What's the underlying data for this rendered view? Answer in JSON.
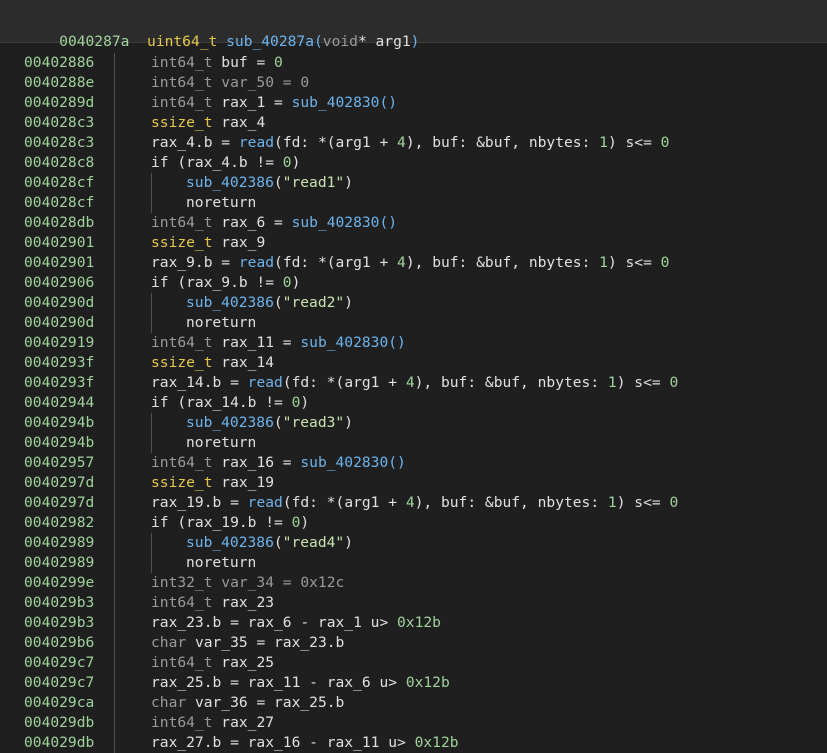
{
  "header": {
    "address": "0040287a",
    "return_type": "uint64_t",
    "function_name": "sub_40287a",
    "open_paren": "(",
    "param_type": "void",
    "param_rest": "* arg1",
    "close_paren": ")"
  },
  "lines": [
    {
      "addr": "00402886",
      "indent": 1,
      "tokens": [
        [
          "int64_t ",
          "dim"
        ],
        [
          "buf",
          ""
        ],
        [
          " = ",
          ""
        ],
        [
          "0",
          "num"
        ]
      ]
    },
    {
      "addr": "0040288e",
      "indent": 1,
      "tokens": [
        [
          "int64_t var_50 = 0",
          "dim"
        ]
      ]
    },
    {
      "addr": "0040289d",
      "indent": 1,
      "tokens": [
        [
          "int64_t ",
          "dim"
        ],
        [
          "rax_1",
          ""
        ],
        [
          " = ",
          ""
        ],
        [
          "sub_402830",
          "func"
        ],
        [
          "()",
          "func"
        ]
      ]
    },
    {
      "addr": "004028c3",
      "indent": 1,
      "tokens": [
        [
          "ssize_t ",
          "type"
        ],
        [
          "rax_4",
          ""
        ]
      ]
    },
    {
      "addr": "004028c3",
      "indent": 1,
      "tokens": [
        [
          "rax_4.b = ",
          ""
        ],
        [
          "read",
          "func"
        ],
        [
          "(fd: *(arg1 + ",
          ""
        ],
        [
          "4",
          "num"
        ],
        [
          "), buf: &buf, nbytes: ",
          ""
        ],
        [
          "1",
          "num"
        ],
        [
          ") s<= ",
          ""
        ],
        [
          "0",
          "num"
        ]
      ]
    },
    {
      "addr": "004028c8",
      "indent": 1,
      "tokens": [
        [
          "if (rax_4.b != ",
          ""
        ],
        [
          "0",
          "num"
        ],
        [
          ")",
          ""
        ]
      ]
    },
    {
      "addr": "004028cf",
      "indent": 2,
      "tokens": [
        [
          "sub_402386",
          "func"
        ],
        [
          "(",
          ""
        ],
        [
          "\"read1\"",
          "str"
        ],
        [
          ")",
          ""
        ]
      ]
    },
    {
      "addr": "004028cf",
      "indent": 2,
      "tokens": [
        [
          "noreturn",
          ""
        ]
      ]
    },
    {
      "addr": "004028db",
      "indent": 1,
      "tokens": [
        [
          "int64_t ",
          "dim"
        ],
        [
          "rax_6",
          ""
        ],
        [
          " = ",
          ""
        ],
        [
          "sub_402830",
          "func"
        ],
        [
          "()",
          "func"
        ]
      ]
    },
    {
      "addr": "00402901",
      "indent": 1,
      "tokens": [
        [
          "ssize_t ",
          "type"
        ],
        [
          "rax_9",
          ""
        ]
      ]
    },
    {
      "addr": "00402901",
      "indent": 1,
      "tokens": [
        [
          "rax_9.b = ",
          ""
        ],
        [
          "read",
          "func"
        ],
        [
          "(fd: *(arg1 + ",
          ""
        ],
        [
          "4",
          "num"
        ],
        [
          "), buf: &buf, nbytes: ",
          ""
        ],
        [
          "1",
          "num"
        ],
        [
          ") s<= ",
          ""
        ],
        [
          "0",
          "num"
        ]
      ]
    },
    {
      "addr": "00402906",
      "indent": 1,
      "tokens": [
        [
          "if (rax_9.b != ",
          ""
        ],
        [
          "0",
          "num"
        ],
        [
          ")",
          ""
        ]
      ]
    },
    {
      "addr": "0040290d",
      "indent": 2,
      "tokens": [
        [
          "sub_402386",
          "func"
        ],
        [
          "(",
          ""
        ],
        [
          "\"read2\"",
          "str"
        ],
        [
          ")",
          ""
        ]
      ]
    },
    {
      "addr": "0040290d",
      "indent": 2,
      "tokens": [
        [
          "noreturn",
          ""
        ]
      ]
    },
    {
      "addr": "00402919",
      "indent": 1,
      "tokens": [
        [
          "int64_t ",
          "dim"
        ],
        [
          "rax_11",
          ""
        ],
        [
          " = ",
          ""
        ],
        [
          "sub_402830",
          "func"
        ],
        [
          "()",
          "func"
        ]
      ]
    },
    {
      "addr": "0040293f",
      "indent": 1,
      "tokens": [
        [
          "ssize_t ",
          "type"
        ],
        [
          "rax_14",
          ""
        ]
      ]
    },
    {
      "addr": "0040293f",
      "indent": 1,
      "tokens": [
        [
          "rax_14.b = ",
          ""
        ],
        [
          "read",
          "func"
        ],
        [
          "(fd: *(arg1 + ",
          ""
        ],
        [
          "4",
          "num"
        ],
        [
          "), buf: &buf, nbytes: ",
          ""
        ],
        [
          "1",
          "num"
        ],
        [
          ") s<= ",
          ""
        ],
        [
          "0",
          "num"
        ]
      ]
    },
    {
      "addr": "00402944",
      "indent": 1,
      "tokens": [
        [
          "if (rax_14.b != ",
          ""
        ],
        [
          "0",
          "num"
        ],
        [
          ")",
          ""
        ]
      ]
    },
    {
      "addr": "0040294b",
      "indent": 2,
      "tokens": [
        [
          "sub_402386",
          "func"
        ],
        [
          "(",
          ""
        ],
        [
          "\"read3\"",
          "str"
        ],
        [
          ")",
          ""
        ]
      ]
    },
    {
      "addr": "0040294b",
      "indent": 2,
      "tokens": [
        [
          "noreturn",
          ""
        ]
      ]
    },
    {
      "addr": "00402957",
      "indent": 1,
      "tokens": [
        [
          "int64_t ",
          "dim"
        ],
        [
          "rax_16",
          ""
        ],
        [
          " = ",
          ""
        ],
        [
          "sub_402830",
          "func"
        ],
        [
          "()",
          "func"
        ]
      ]
    },
    {
      "addr": "0040297d",
      "indent": 1,
      "tokens": [
        [
          "ssize_t ",
          "type"
        ],
        [
          "rax_19",
          ""
        ]
      ]
    },
    {
      "addr": "0040297d",
      "indent": 1,
      "tokens": [
        [
          "rax_19.b = ",
          ""
        ],
        [
          "read",
          "func"
        ],
        [
          "(fd: *(arg1 + ",
          ""
        ],
        [
          "4",
          "num"
        ],
        [
          "), buf: &buf, nbytes: ",
          ""
        ],
        [
          "1",
          "num"
        ],
        [
          ") s<= ",
          ""
        ],
        [
          "0",
          "num"
        ]
      ]
    },
    {
      "addr": "00402982",
      "indent": 1,
      "tokens": [
        [
          "if (rax_19.b != ",
          ""
        ],
        [
          "0",
          "num"
        ],
        [
          ")",
          ""
        ]
      ]
    },
    {
      "addr": "00402989",
      "indent": 2,
      "tokens": [
        [
          "sub_402386",
          "func"
        ],
        [
          "(",
          ""
        ],
        [
          "\"read4\"",
          "str"
        ],
        [
          ")",
          ""
        ]
      ]
    },
    {
      "addr": "00402989",
      "indent": 2,
      "tokens": [
        [
          "noreturn",
          ""
        ]
      ]
    },
    {
      "addr": "0040299e",
      "indent": 1,
      "tokens": [
        [
          "int32_t var_34 = 0x12c",
          "dim"
        ]
      ]
    },
    {
      "addr": "004029b3",
      "indent": 1,
      "tokens": [
        [
          "int64_t ",
          "dim"
        ],
        [
          "rax_23",
          ""
        ]
      ]
    },
    {
      "addr": "004029b3",
      "indent": 1,
      "tokens": [
        [
          "rax_23.b = rax_6 - rax_1 u> ",
          ""
        ],
        [
          "0x12b",
          "num"
        ]
      ]
    },
    {
      "addr": "004029b6",
      "indent": 1,
      "tokens": [
        [
          "char ",
          "dim"
        ],
        [
          "var_35 = rax_23.b",
          ""
        ]
      ]
    },
    {
      "addr": "004029c7",
      "indent": 1,
      "tokens": [
        [
          "int64_t ",
          "dim"
        ],
        [
          "rax_25",
          ""
        ]
      ]
    },
    {
      "addr": "004029c7",
      "indent": 1,
      "tokens": [
        [
          "rax_25.b = rax_11 - rax_6 u> ",
          ""
        ],
        [
          "0x12b",
          "num"
        ]
      ]
    },
    {
      "addr": "004029ca",
      "indent": 1,
      "tokens": [
        [
          "char ",
          "dim"
        ],
        [
          "var_36 = rax_25.b",
          ""
        ]
      ]
    },
    {
      "addr": "004029db",
      "indent": 1,
      "tokens": [
        [
          "int64_t ",
          "dim"
        ],
        [
          "rax_27",
          ""
        ]
      ]
    },
    {
      "addr": "004029db",
      "indent": 1,
      "tokens": [
        [
          "rax_27.b = rax_16 - rax_11 u> ",
          ""
        ],
        [
          "0x12b",
          "num"
        ]
      ]
    }
  ],
  "colors": {
    "background": "#1f1f1f",
    "header_bg": "#2c2c2c",
    "address": "#9fd39a",
    "type": "#e6c84a",
    "function": "#6cb4ee",
    "number": "#9fd39a",
    "string": "#c9e4b0",
    "dim": "#9a9a9a",
    "text": "#e0e0e0"
  }
}
